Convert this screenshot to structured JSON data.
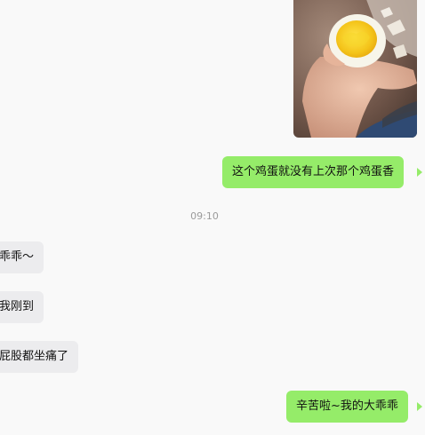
{
  "conversation": {
    "timestamp": "09:10",
    "messages": [
      {
        "side": "right",
        "type": "image",
        "alt": ""
      },
      {
        "side": "right",
        "type": "text",
        "text": "这个鸡蛋就没有上次那个鸡蛋香"
      },
      {
        "side": "left",
        "type": "text",
        "text": "乖乖～"
      },
      {
        "side": "left",
        "type": "text",
        "text": "我刚到"
      },
      {
        "side": "left",
        "type": "text",
        "text": "屁股都坐痛了"
      },
      {
        "side": "right",
        "type": "text",
        "text": "辛苦啦~我的大乖乖"
      }
    ]
  },
  "colors": {
    "background": "#f9f9f9",
    "sent_bubble": "#95ec69",
    "received_bubble": "#ececee",
    "timestamp": "#9b9b9b"
  }
}
